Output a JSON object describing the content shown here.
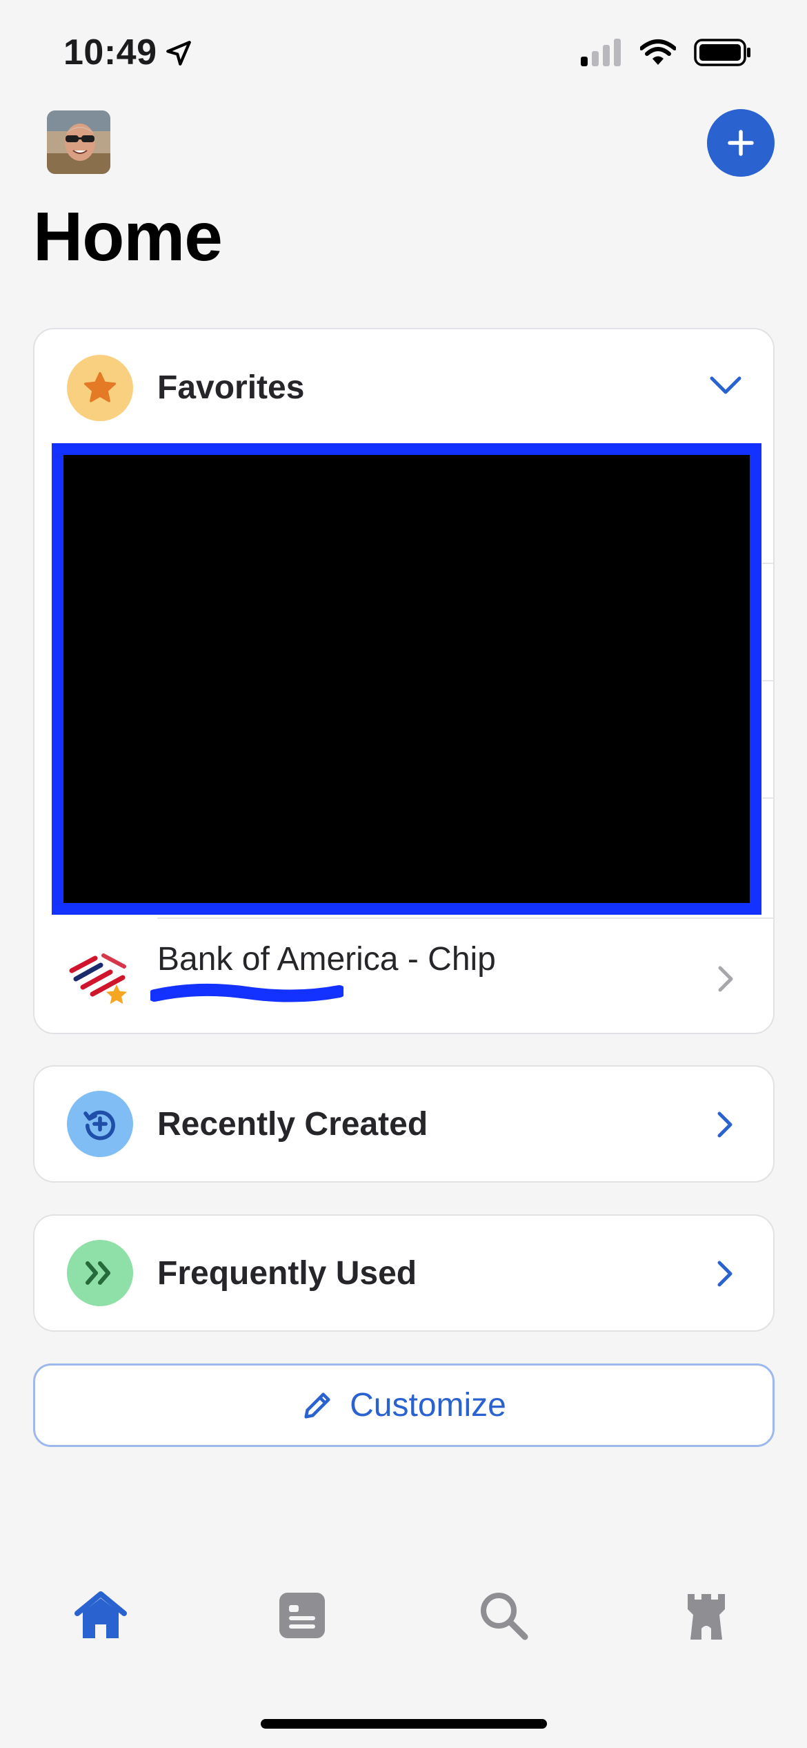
{
  "status_bar": {
    "time": "10:49",
    "icons": [
      "location-arrow-icon",
      "cellular-signal-icon",
      "wifi-icon",
      "battery-icon"
    ]
  },
  "header": {
    "title": "Home",
    "avatar": "user-avatar",
    "add_icon": "plus-icon"
  },
  "favorites": {
    "label": "Favorites",
    "icon": "star-icon",
    "expanded": true,
    "items": [
      {
        "title": "Bank of America - Chip",
        "subtitle_redacted": true,
        "favorite": true
      }
    ]
  },
  "sections": [
    {
      "label": "Recently Created",
      "icon": "recent-plus-icon"
    },
    {
      "label": "Frequently Used",
      "icon": "double-chevron-icon"
    }
  ],
  "customize": {
    "label": "Customize",
    "icon": "pencil-icon"
  },
  "tab_bar": {
    "tabs": [
      {
        "name": "home",
        "icon": "home-icon",
        "active": true
      },
      {
        "name": "items",
        "icon": "list-icon",
        "active": false
      },
      {
        "name": "search",
        "icon": "search-icon",
        "active": false
      },
      {
        "name": "security",
        "icon": "tower-icon",
        "active": false
      }
    ]
  },
  "colors": {
    "accent": "#2a62d0",
    "favorites_bg": "#f9d07f",
    "favorites_star": "#e47a26",
    "recent_bg": "#7fbdf4",
    "frequent_bg": "#8edfa8",
    "frequent_glyph": "#256a3a",
    "redaction_border": "#1432ff",
    "tab_inactive": "#8e8e93"
  }
}
